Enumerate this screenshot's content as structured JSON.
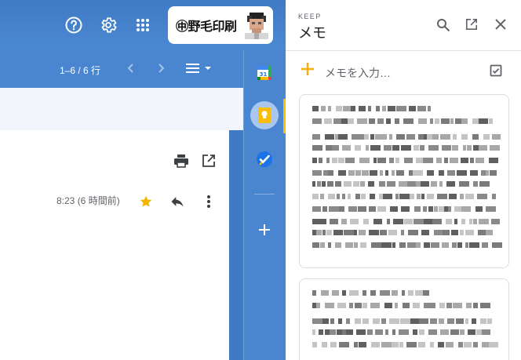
{
  "gmail": {
    "header": {
      "help_icon": "help-circle-icon",
      "settings_icon": "gear-icon",
      "apps_icon": "apps-grid-icon",
      "brand_text": "㊥野毛印刷"
    },
    "toolbar": {
      "pager": "1–6 / 6 行",
      "prev_icon": "chevron-left-icon",
      "next_icon": "chevron-right-icon",
      "density_icon": "density-menu-icon"
    },
    "message": {
      "time": "8:23 (6 時間前)",
      "print_icon": "print-icon",
      "open_new_icon": "open-in-new-icon",
      "star_icon": "star-icon",
      "reply_icon": "reply-icon",
      "more_icon": "more-vert-icon",
      "star_color": "#f4b400"
    }
  },
  "side_rail": {
    "apps": [
      {
        "name": "Calendar",
        "icon": "calendar-icon",
        "badge": "31"
      },
      {
        "name": "Keep",
        "icon": "keep-bulb-icon",
        "active": true
      },
      {
        "name": "Tasks",
        "icon": "tasks-check-icon"
      }
    ],
    "add_icon": "plus-icon"
  },
  "keep": {
    "eyebrow": "KEEP",
    "title": "メモ",
    "search_icon": "search-icon",
    "open_new_icon": "open-in-new-icon",
    "close_icon": "close-icon",
    "add_placeholder": "メモを入力…",
    "add_icon": "plus-icon",
    "checkbox_icon": "checkbox-icon",
    "accent_color": "#f9ab00",
    "notes": [
      {
        "content": "pixelated (obscured) note text"
      },
      {
        "content": "pixelated (obscured) note text"
      }
    ]
  }
}
